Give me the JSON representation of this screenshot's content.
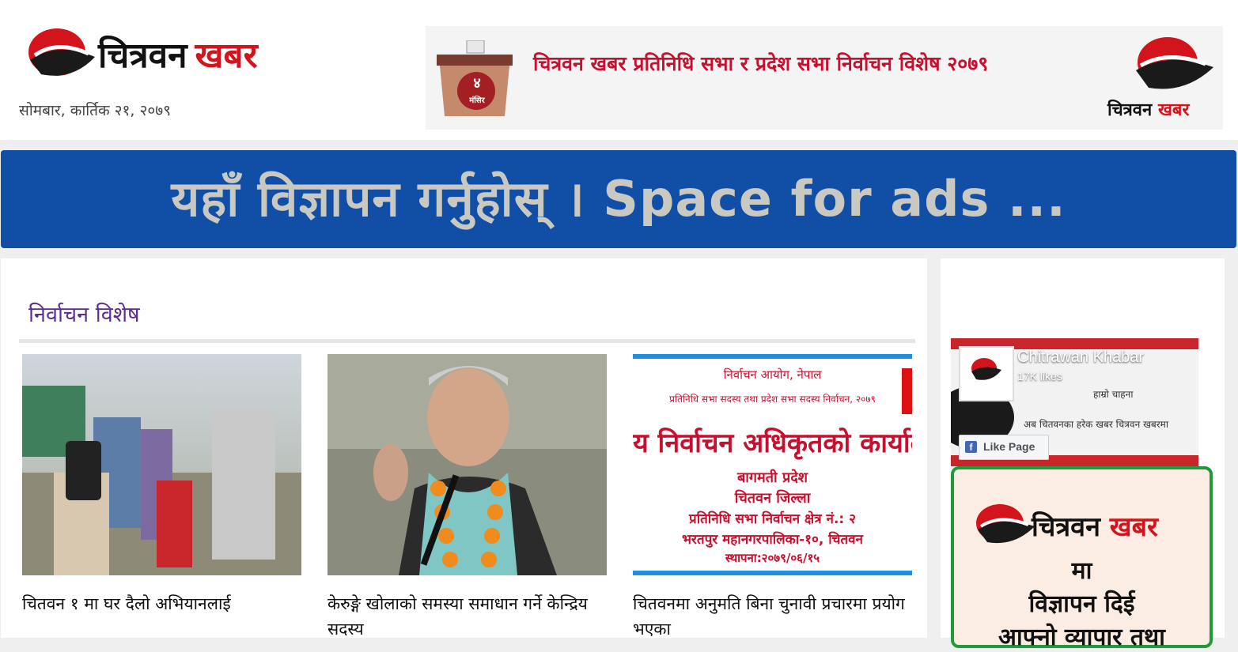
{
  "header": {
    "brand_part1": "चित्रवन",
    "brand_part2": "खबर",
    "date": "सोमबार, कार्तिक २१, २०७९"
  },
  "top_banner": {
    "headline": "चित्रवन खबर प्रतिनिधि सभा र प्रदेश सभा निर्वाचन विशेष २०७९",
    "ballot_day": "४",
    "ballot_month": "मंसिर",
    "logo_part1": "चित्रवन",
    "logo_part2": "खबर"
  },
  "wide_ad": {
    "text": "यहाँ विज्ञापन गर्नुहोस् । Space for ads ..."
  },
  "section": {
    "title": "निर्वाचन विशेष"
  },
  "articles": [
    {
      "title": "चितवन १ मा घर दैलो अभियानलाई"
    },
    {
      "title": "केरुङ्गे खोलाको समस्या समाधान गर्ने केन्द्रिय सदस्य"
    },
    {
      "title": "चितवनमा अनुमति बिना चुनावी प्रचारमा प्रयोग भएका"
    }
  ],
  "notice_image": {
    "line1": "निर्वाचन आयोग, नेपाल",
    "line2": "प्रतिनिधि सभा सदस्य तथा प्रदेश सभा सदस्य निर्वाचन, २०७९",
    "line3": "य निर्वाचन अधिकृतको कार्याल",
    "line4": "बागमती प्रदेश",
    "line5": "चितवन जिल्ला",
    "line6": "प्रतिनिधि सभा निर्वाचन क्षेत्र नं.: २",
    "line7": "भरतपुर महानगरपालिका-१०, चितवन",
    "line8": "स्थापना:२०७९/०६/१५"
  },
  "facebook": {
    "page_name": "Chitrawan Khabar",
    "likes": "17K likes",
    "like_button": "Like Page",
    "cover_text1": "हाम्रो चाहना",
    "cover_text2": "अब चितवनका हरेक खबर चित्रवन खबरमा"
  },
  "side_ad": {
    "brand_part1": "चित्रवन",
    "brand_part2": "खबर",
    "line1": "मा",
    "line2": "विज्ञापन दिई",
    "line3": "आफ्नो व्यापार तथा"
  },
  "colors": {
    "brand_red": "#d4141c",
    "ad_blue": "#114fa6",
    "section_purple": "#5b2d8e",
    "ad_green_border": "#1f9c3a"
  }
}
